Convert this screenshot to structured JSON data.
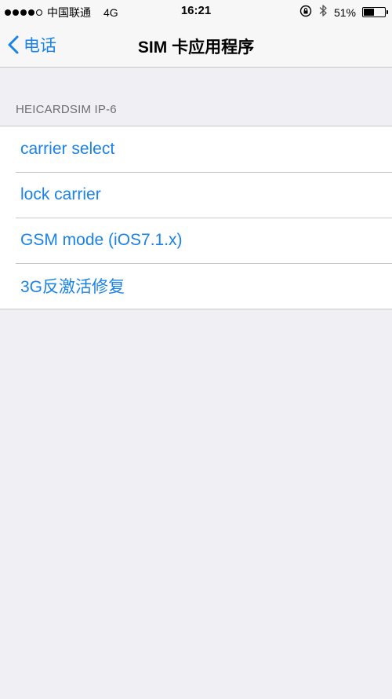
{
  "status_bar": {
    "signal_filled": 4,
    "signal_total": 5,
    "carrier": "中国联通",
    "network": "4G",
    "time": "16:21",
    "battery_percent": "51%",
    "battery_level": 0.51,
    "icons": [
      "orientation-lock-icon",
      "bluetooth-icon",
      "battery-icon"
    ]
  },
  "nav": {
    "back_label": "电话",
    "title": "SIM 卡应用程序"
  },
  "section": {
    "header": "HEICARDSIM IP-6"
  },
  "items": [
    {
      "label": "carrier select"
    },
    {
      "label": "lock carrier"
    },
    {
      "label": "GSM mode (iOS7.1.x)"
    },
    {
      "label": "3G反激活修复"
    }
  ],
  "colors": {
    "accent": "#1a82e8",
    "background": "#efeff4",
    "bar": "#f7f7f7",
    "separator": "#c8c7cc",
    "section_text": "#6d6d72"
  }
}
